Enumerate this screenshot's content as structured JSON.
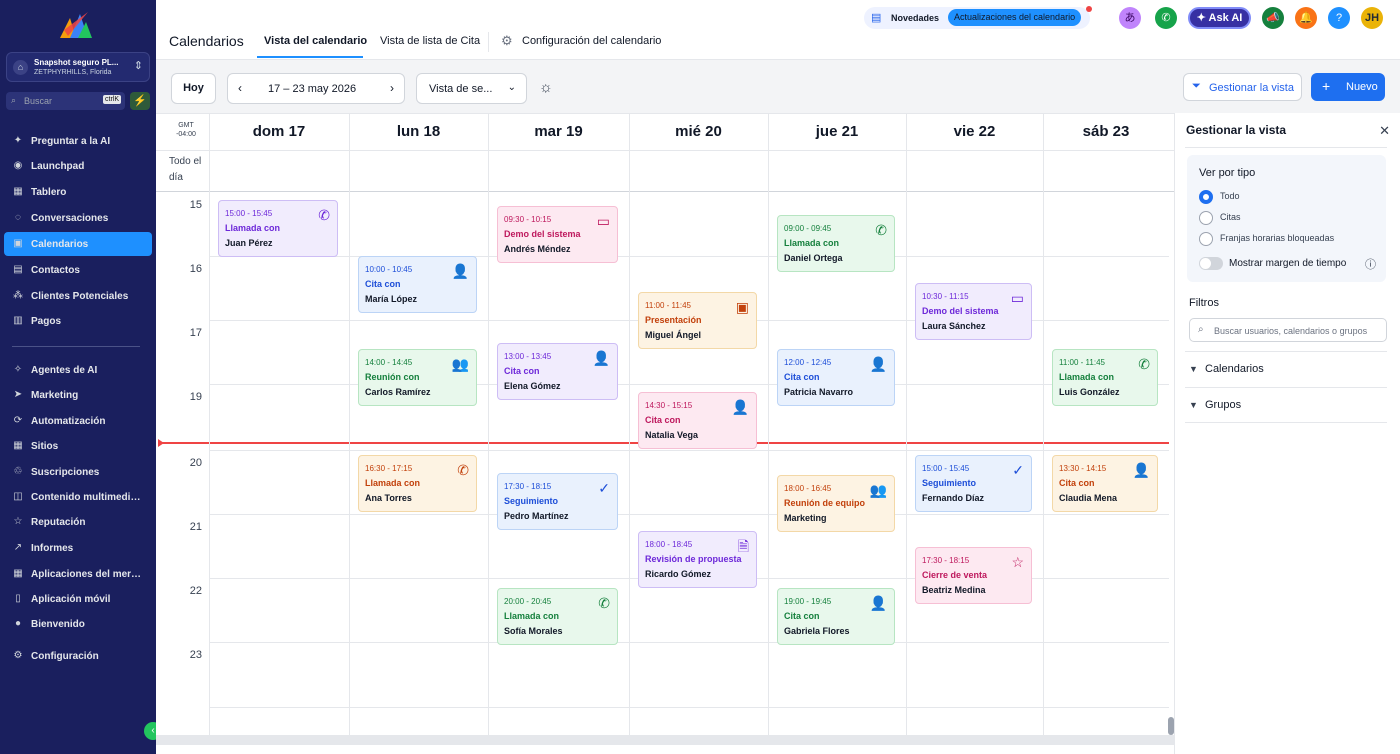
{
  "sidebar": {
    "account": {
      "name": "Snapshot seguro PL...",
      "location": "ZETPHYRHILLS, Florida"
    },
    "search": {
      "placeholder": "Buscar",
      "shortcut": "ctrlK"
    },
    "items": [
      {
        "label": "Preguntar a la AI",
        "icon": "sparkle-icon"
      },
      {
        "label": "Launchpad",
        "icon": "rocket-icon"
      },
      {
        "label": "Tablero",
        "icon": "dashboard-icon"
      },
      {
        "label": "Conversaciones",
        "icon": "chat-icon"
      },
      {
        "label": "Calendarios",
        "icon": "calendar-icon",
        "active": true
      },
      {
        "label": "Contactos",
        "icon": "contacts-icon"
      },
      {
        "label": "Clientes Potenciales",
        "icon": "leads-icon"
      },
      {
        "label": "Pagos",
        "icon": "payments-icon"
      },
      {
        "label": "Agentes de AI",
        "icon": "ai-agent-icon"
      },
      {
        "label": "Marketing",
        "icon": "send-icon"
      },
      {
        "label": "Automatización",
        "icon": "automation-icon"
      },
      {
        "label": "Sitios",
        "icon": "sites-icon"
      },
      {
        "label": "Suscripciones",
        "icon": "subscriptions-icon"
      },
      {
        "label": "Contenido multimedia ...",
        "icon": "media-icon"
      },
      {
        "label": "Reputación",
        "icon": "star-icon"
      },
      {
        "label": "Informes",
        "icon": "chart-icon"
      },
      {
        "label": "Aplicaciones del merca...",
        "icon": "apps-icon"
      },
      {
        "label": "Aplicación móvil",
        "icon": "mobile-icon"
      },
      {
        "label": "Bienvenido",
        "icon": "welcome-icon"
      },
      {
        "label": "Configuración",
        "icon": "gear-icon"
      }
    ]
  },
  "header": {
    "title": "Calendarios",
    "tabs": [
      "Vista del calendario",
      "Vista de lista de Cita",
      "Configuración del calendario"
    ],
    "news_label": "Novedades",
    "news_pill": "Actualizaciones del calendario",
    "ask_ai": "Ask AI",
    "avatar": "JH"
  },
  "toolbar": {
    "today": "Hoy",
    "range": "17 – 23 may 2026",
    "view": "Vista de se...",
    "manage_view": "Gestionar la vista",
    "new": "Nuevo"
  },
  "calendar": {
    "timezone": [
      "GMT",
      "-04:00"
    ],
    "allday": [
      "Todo el",
      "día"
    ],
    "days": [
      "dom 17",
      "lun 18",
      "mar 19",
      "mié 20",
      "jue 21",
      "vie 22",
      "sáb 23"
    ],
    "hours": [
      "15",
      "16",
      "17",
      "19",
      "20",
      "21",
      "22",
      "23"
    ],
    "events": [
      {
        "day": 0,
        "time": "15:00 - 15:45",
        "line1": "Llamada con",
        "line2": "Juan Pérez",
        "color": "purple",
        "icon": "phone-icon",
        "glyph": "✆"
      },
      {
        "day": 1,
        "time": "10:00 - 10:45",
        "line1": "Cita con",
        "line2": "María López",
        "color": "blue",
        "icon": "user-icon",
        "glyph": "👤"
      },
      {
        "day": 1,
        "time": "14:00 - 14:45",
        "line1": "Reunión con",
        "line2": "Carlos Ramírez",
        "color": "green",
        "icon": "group-icon",
        "glyph": "👥"
      },
      {
        "day": 1,
        "time": "16:30 - 17:15",
        "line1": "Llamada con",
        "line2": "Ana Torres",
        "color": "orange",
        "icon": "phone-icon",
        "glyph": "✆"
      },
      {
        "day": 2,
        "time": "09:30 - 10:15",
        "line1": "Demo del sistema",
        "line2": "Andrés Méndez",
        "color": "pink",
        "icon": "monitor-icon",
        "glyph": "▭"
      },
      {
        "day": 2,
        "time": "13:00 - 13:45",
        "line1": "Cita con",
        "line2": "Elena Gómez",
        "color": "purple",
        "icon": "user-icon",
        "glyph": "👤"
      },
      {
        "day": 2,
        "time": "17:30 - 18:15",
        "line1": "Seguimiento",
        "line2": "Pedro Martínez",
        "color": "blue",
        "icon": "check-circle-icon",
        "glyph": "✓"
      },
      {
        "day": 2,
        "time": "20:00 - 20:45",
        "line1": "Llamada con",
        "line2": "Sofía Morales",
        "color": "green",
        "icon": "phone-icon",
        "glyph": "✆"
      },
      {
        "day": 3,
        "time": "11:00 - 11:45",
        "line1": "Presentación",
        "line2": "Miguel Ángel",
        "color": "orange",
        "icon": "presentation-icon",
        "glyph": "▣"
      },
      {
        "day": 3,
        "time": "14:30 - 15:15",
        "line1": "Cita con",
        "line2": "Natalia Vega",
        "color": "pink",
        "icon": "user-icon",
        "glyph": "👤"
      },
      {
        "day": 3,
        "time": "18:00 - 18:45",
        "line1": "Revisión de propuesta",
        "line2": "Ricardo Gómez",
        "color": "purple",
        "icon": "document-icon",
        "glyph": "🗎"
      },
      {
        "day": 4,
        "time": "09:00 - 09:45",
        "line1": "Llamada con",
        "line2": "Daniel Ortega",
        "color": "green",
        "icon": "phone-icon",
        "glyph": "✆"
      },
      {
        "day": 4,
        "time": "12:00 - 12:45",
        "line1": "Cita con",
        "line2": "Patricia Navarro",
        "color": "blue",
        "icon": "user-icon",
        "glyph": "👤"
      },
      {
        "day": 4,
        "time": "18:00 - 16:45",
        "line1": "Reunión de equipo",
        "line2": "Marketing",
        "color": "orange",
        "icon": "group-icon",
        "glyph": "👥"
      },
      {
        "day": 4,
        "time": "19:00 - 19:45",
        "line1": "Cita con",
        "line2": "Gabriela Flores",
        "color": "green",
        "icon": "user-icon",
        "glyph": "👤"
      },
      {
        "day": 5,
        "time": "10:30 - 11:15",
        "line1": "Demo del sistema",
        "line2": "Laura Sánchez",
        "color": "purple",
        "icon": "monitor-icon",
        "glyph": "▭"
      },
      {
        "day": 5,
        "time": "15:00 - 15:45",
        "line1": "Seguimiento",
        "line2": "Fernando Díaz",
        "color": "blue",
        "icon": "check-circle-icon",
        "glyph": "✓"
      },
      {
        "day": 5,
        "time": "17:30 - 18:15",
        "line1": "Cierre de venta",
        "line2": "Beatriz Medina",
        "color": "pink",
        "icon": "star-icon",
        "glyph": "☆"
      },
      {
        "day": 6,
        "time": "11:00 - 11:45",
        "line1": "Llamada con",
        "line2": "Luis González",
        "color": "green",
        "icon": "phone-icon",
        "glyph": "✆"
      },
      {
        "day": 6,
        "time": "13:30 - 14:15",
        "line1": "Cita con",
        "line2": "Claudia Mena",
        "color": "orange",
        "icon": "user-icon",
        "glyph": "👤"
      }
    ]
  },
  "palette": {
    "purple": {
      "bg": "#f1ecfd",
      "border": "#cdbdf5",
      "fg": "#6d28d9"
    },
    "blue": {
      "bg": "#e9f1fd",
      "border": "#bcd4f6",
      "fg": "#1d4ed8"
    },
    "green": {
      "bg": "#e8f8ec",
      "border": "#b7e5c2",
      "fg": "#15803d"
    },
    "orange": {
      "bg": "#fdf3e3",
      "border": "#f3d8a7",
      "fg": "#c2410c"
    },
    "pink": {
      "bg": "#fde9f1",
      "border": "#f6bfd4",
      "fg": "#be185d"
    }
  },
  "panel": {
    "title": "Gestionar la vista",
    "by_type": "Ver por tipo",
    "types": [
      "Todo",
      "Citas",
      "Franjas horarias bloqueadas"
    ],
    "toggle_label": "Mostrar margen de tiempo",
    "filters": "Filtros",
    "filter_placeholder": "Buscar usuarios, calendarios o grupos",
    "sections": [
      "Calendarios",
      "Grupos"
    ]
  }
}
